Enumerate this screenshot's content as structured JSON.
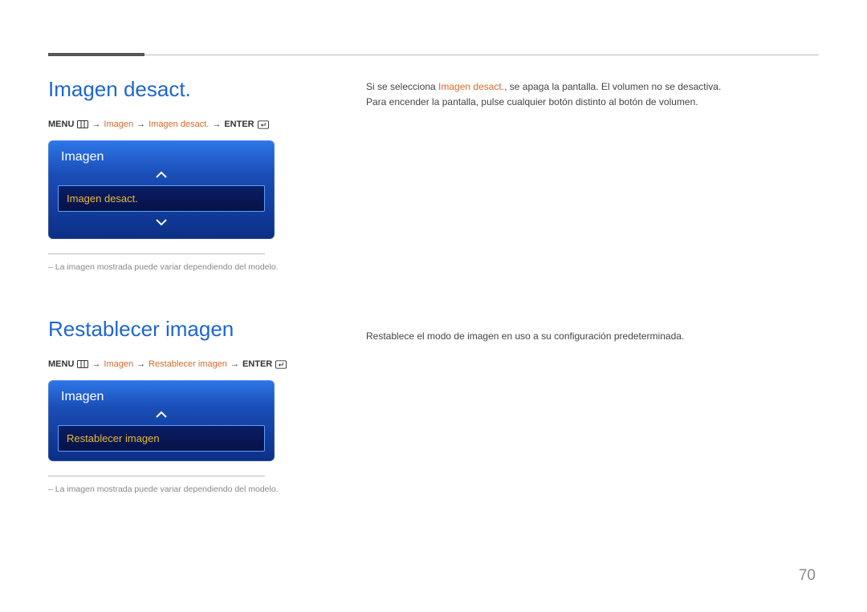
{
  "page_number": "70",
  "section1": {
    "heading": "Imagen desact.",
    "breadcrumb": {
      "menu": "MENU",
      "step1": "Imagen",
      "step2": "Imagen desact.",
      "enter": "ENTER"
    },
    "osd": {
      "title": "Imagen",
      "item": "Imagen desact."
    },
    "note": "–  La imagen mostrada puede variar dependiendo del modelo.",
    "desc_a": "Si se selecciona ",
    "desc_a_em": "Imagen desact.",
    "desc_a_tail": ", se apaga la pantalla. El volumen no se desactiva.",
    "desc_b": "Para encender la pantalla, pulse cualquier botón distinto al botón de volumen."
  },
  "section2": {
    "heading": "Restablecer imagen",
    "breadcrumb": {
      "menu": "MENU",
      "step1": "Imagen",
      "step2": "Restablecer imagen",
      "enter": "ENTER"
    },
    "osd": {
      "title": "Imagen",
      "item": "Restablecer imagen"
    },
    "note": "–  La imagen mostrada puede variar dependiendo del modelo.",
    "desc": "Restablece el modo de imagen en uso a su configuración predeterminada."
  }
}
